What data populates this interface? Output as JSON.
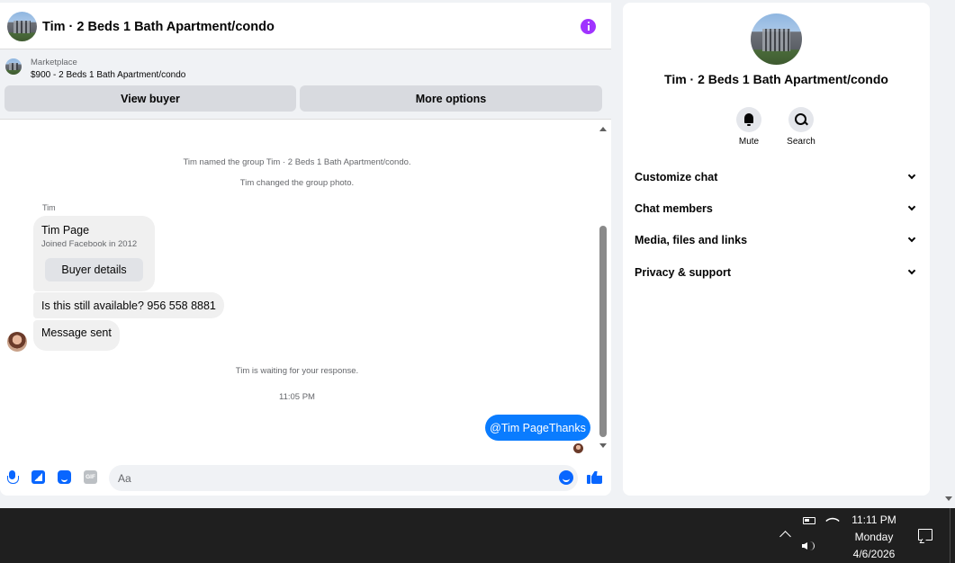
{
  "header": {
    "title": "Tim · 2 Beds 1 Bath Apartment/condo",
    "info_icon": "info-icon",
    "accent_color": "#a033ff"
  },
  "marketplace": {
    "label": "Marketplace",
    "listing": "$900 - 2 Beds 1 Bath Apartment/condo",
    "view_buyer": "View buyer",
    "more_options": "More options"
  },
  "messages": {
    "system_1": "Tim named the group Tim · 2 Beds 1 Bath Apartment/condo.",
    "system_2": "Tim changed the group photo.",
    "sender_name": "Tim",
    "profile_card": {
      "name": "Tim Page",
      "subtitle": "Joined Facebook in 2012",
      "button": "Buyer details"
    },
    "incoming_1": "Is this still available? 956 558 8881",
    "incoming_2": "Message sent",
    "system_3": "Tim is waiting for your response.",
    "timestamp": "11:05 PM",
    "outgoing_1": "@Tim PageThanks",
    "outgoing_color": "#0a7cff"
  },
  "composer": {
    "placeholder": "Aa",
    "gif_label": "GIF",
    "icons": [
      "microphone-icon",
      "photo-icon",
      "sticker-icon",
      "gif-icon",
      "emoji-icon",
      "thumbs-up-icon"
    ]
  },
  "info_panel": {
    "title": "Tim · 2 Beds 1 Bath Apartment/condo",
    "actions": [
      {
        "label": "Mute",
        "icon": "bell-icon"
      },
      {
        "label": "Search",
        "icon": "search-icon"
      }
    ],
    "sections": [
      "Customize chat",
      "Chat members",
      "Media, files and links",
      "Privacy & support"
    ]
  },
  "taskbar": {
    "time": "11:11 PM",
    "day": "Monday",
    "date": "4/6/2026",
    "icons": [
      "chevron-up-icon",
      "battery-icon",
      "wifi-icon",
      "speaker-icon",
      "notifications-icon"
    ]
  }
}
